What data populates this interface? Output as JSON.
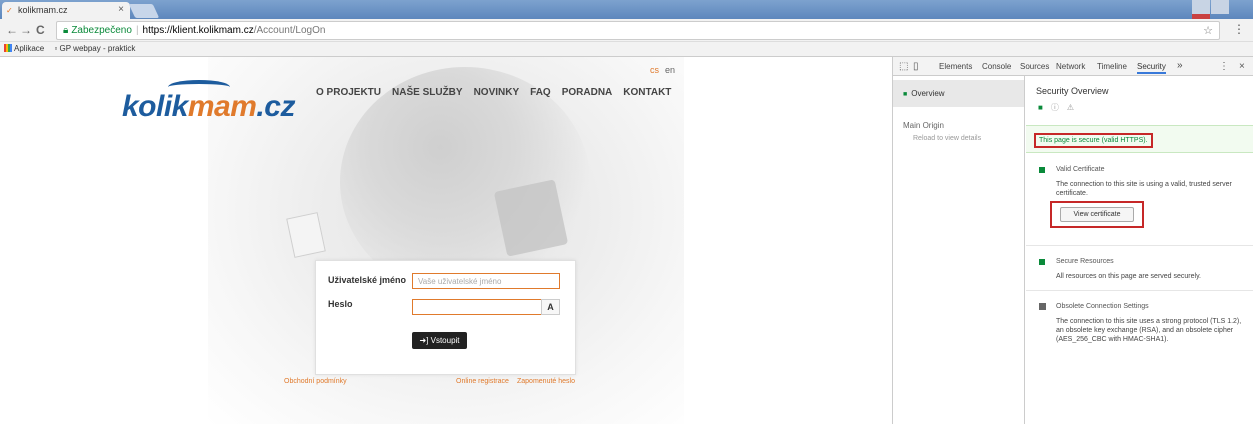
{
  "browser": {
    "tab_title": "kolikmam.cz",
    "tab_close": "×",
    "back": "←",
    "forward": "→",
    "reload": "C",
    "secure_label": "Zabezpečeno",
    "url_host": "https://klient.kolikmam.cz",
    "url_path": "/Account/LogOn",
    "star": "☆",
    "menu": "⋮",
    "bookmarks": [
      "Aplikace",
      "GP webpay - praktick"
    ]
  },
  "site": {
    "logo_a": "kolik",
    "logo_b": "mam",
    "logo_c": ".cz",
    "nav": [
      "O PROJEKTU",
      "NAŠE SLUŽBY",
      "NOVINKY",
      "FAQ",
      "PORADNA",
      "KONTAKT"
    ],
    "lang_cs": "cs",
    "lang_en": "en",
    "login": {
      "username_label": "Uživatelské jméno",
      "username_placeholder": "Vaše uživatelské jméno",
      "password_label": "Heslo",
      "reveal_label": "A",
      "submit_label": "Vstoupit"
    },
    "links": {
      "terms": "Obchodní podmínky",
      "register": "Online registrace",
      "forgot": "Zapomenuté heslo"
    }
  },
  "devtools": {
    "tabs": [
      "Elements",
      "Console",
      "Sources",
      "Network",
      "Timeline",
      "Security"
    ],
    "active_tab": "Security",
    "more": "»",
    "menu": "⋮",
    "close": "×",
    "sidebar": {
      "overview": "Overview",
      "main_origin": "Main Origin",
      "reload_hint": "Reload to view details"
    },
    "security": {
      "title": "Security Overview",
      "summary": "This page is secure (valid HTTPS).",
      "items": [
        {
          "heading": "Valid Certificate",
          "detail": "The connection to this site is using a valid, trusted server certificate.",
          "status_color": "#0a8a3a"
        },
        {
          "heading": "Secure Resources",
          "detail": "All resources on this page are served securely.",
          "status_color": "#0a8a3a"
        },
        {
          "heading": "Obsolete Connection Settings",
          "detail": "The connection to this site uses a strong protocol (TLS 1.2), an obsolete key exchange (RSA), and an obsolete cipher (AES_256_CBC with HMAC-SHA1).",
          "status_color": "#666666"
        }
      ],
      "view_certificate": "View certificate"
    }
  }
}
